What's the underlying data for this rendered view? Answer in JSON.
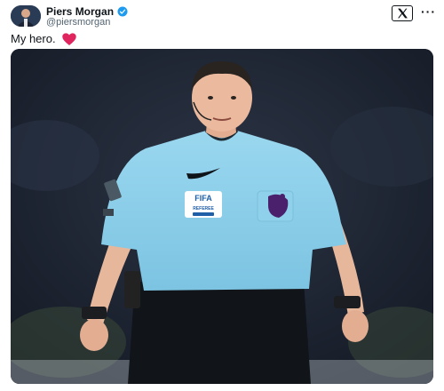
{
  "author": {
    "name": "Piers Morgan",
    "handle": "@piersmorgan"
  },
  "tweet": {
    "text": "My hero."
  },
  "image_content": {
    "shirt_badge_fifa": "FIFA",
    "shirt_badge_sub": "REFEREE"
  },
  "colors": {
    "shirt": "#8fd0ea",
    "verified": "#1d9bf0",
    "heart": "#e0245e"
  },
  "icons": {
    "verified": "verified-badge-icon",
    "x_logo": "x-logo-icon",
    "more": "more-options-icon",
    "heart": "heart-icon"
  }
}
